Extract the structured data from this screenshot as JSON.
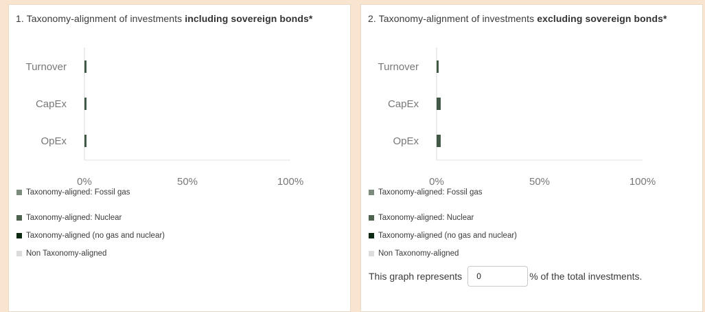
{
  "chart_data": [
    {
      "type": "bar",
      "orientation": "horizontal",
      "stacked": true,
      "title": "1. Taxonomy-alignment of investments including sovereign bonds*",
      "title_plain": "1. Taxonomy-alignment of investments ",
      "title_bold": "including sovereign bonds*",
      "categories": [
        "Turnover",
        "CapEx",
        "OpEx"
      ],
      "xlim": [
        0,
        100
      ],
      "xticks": [
        "0%",
        "50%",
        "100%"
      ],
      "series": [
        {
          "name": "Taxonomy-aligned: Fossil gas",
          "values": [
            0,
            0,
            0
          ],
          "color": "#7b8c7c"
        },
        {
          "name": "Taxonomy-aligned: Nuclear",
          "values": [
            0,
            0,
            0
          ],
          "color": "#4d6350"
        },
        {
          "name": "Taxonomy-aligned (no gas and nuclear)",
          "values": [
            1,
            1,
            1
          ],
          "color": "#0c2a12"
        },
        {
          "name": "Non Taxonomy-aligned",
          "values": [
            0,
            0,
            0
          ],
          "color": "#dcdcdc"
        }
      ]
    },
    {
      "type": "bar",
      "orientation": "horizontal",
      "stacked": true,
      "title": "2. Taxonomy-alignment of investments excluding sovereign bonds*",
      "title_plain": "2. Taxonomy-alignment of investments ",
      "title_bold": "excluding sovereign bonds*",
      "categories": [
        "Turnover",
        "CapEx",
        "OpEx"
      ],
      "xlim": [
        0,
        100
      ],
      "xticks": [
        "0%",
        "50%",
        "100%"
      ],
      "series": [
        {
          "name": "Taxonomy-aligned: Fossil gas",
          "values": [
            0,
            0,
            0
          ],
          "color": "#7b8c7c"
        },
        {
          "name": "Taxonomy-aligned: Nuclear",
          "values": [
            0,
            0,
            0
          ],
          "color": "#4d6350"
        },
        {
          "name": "Taxonomy-aligned (no gas and nuclear)",
          "values": [
            1,
            2,
            2
          ],
          "color": "#0c2a12"
        },
        {
          "name": "Non Taxonomy-aligned",
          "values": [
            0,
            0,
            0
          ],
          "color": "#dcdcdc"
        }
      ]
    }
  ],
  "represents": {
    "prefix": "This graph represents",
    "value": "0",
    "suffix": "% of the total investments."
  }
}
